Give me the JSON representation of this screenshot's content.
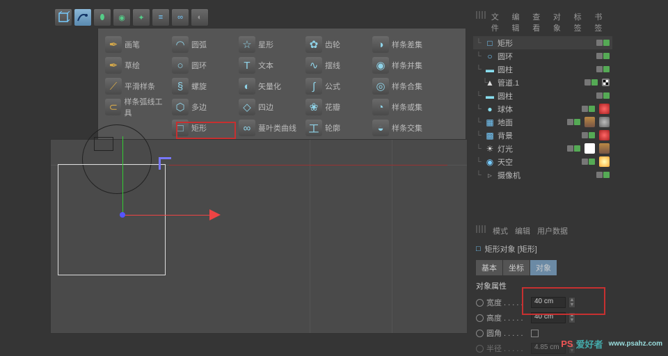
{
  "toolbar": {
    "cube": "◫",
    "pen": "✒"
  },
  "spline_menu": [
    {
      "id": "freehand",
      "label": "画笔",
      "col": "gold",
      "gly": "✒"
    },
    {
      "id": "arc",
      "label": "圆弧",
      "gly": "◠"
    },
    {
      "id": "star",
      "label": "星形",
      "gly": "☆"
    },
    {
      "id": "gear",
      "label": "齿轮",
      "gly": "✿"
    },
    {
      "id": "mask",
      "label": "样条差集",
      "gly": "◑"
    },
    {
      "id": "sketch",
      "label": "草绘",
      "col": "gold",
      "gly": "✒"
    },
    {
      "id": "circle",
      "label": "圆环",
      "gly": "○"
    },
    {
      "id": "text",
      "label": "文本",
      "gly": "T"
    },
    {
      "id": "cycloid",
      "label": "摆线",
      "gly": "∿"
    },
    {
      "id": "union",
      "label": "样条并集",
      "gly": "◉"
    },
    {
      "id": "smooth",
      "label": "平滑样条",
      "col": "gold",
      "gly": "⟋"
    },
    {
      "id": "helix",
      "label": "螺旋",
      "gly": "§"
    },
    {
      "id": "vectorize",
      "label": "矢量化",
      "gly": "◐"
    },
    {
      "id": "formula",
      "label": "公式",
      "gly": "∫"
    },
    {
      "id": "and",
      "label": "样条合集",
      "gly": "◎"
    },
    {
      "id": "arctool",
      "label": "样条弧线工具",
      "col": "gold",
      "gly": "⊂"
    },
    {
      "id": "nside",
      "label": "多边",
      "gly": "⬡"
    },
    {
      "id": "4side",
      "label": "四边",
      "gly": "◇"
    },
    {
      "id": "flower",
      "label": "花瓣",
      "gly": "❀"
    },
    {
      "id": "or",
      "label": "样条或集",
      "gly": "◔"
    },
    {
      "id": "sp1",
      "label": "",
      "gly": ""
    },
    {
      "id": "rectangle",
      "label": "矩形",
      "gly": "□"
    },
    {
      "id": "cissoid",
      "label": "蔓叶类曲线",
      "gly": "∞"
    },
    {
      "id": "profile",
      "label": "轮廓",
      "gly": "工"
    },
    {
      "id": "intersect",
      "label": "样条交集",
      "gly": "◒"
    }
  ],
  "obj_header": [
    "文件",
    "编辑",
    "查看",
    "对象",
    "标签",
    "书签"
  ],
  "objects": [
    {
      "id": "rect",
      "label": "矩形",
      "sel": true,
      "icon": "□",
      "color": "#7cf",
      "tags": []
    },
    {
      "id": "circ",
      "label": "圆环",
      "icon": "○",
      "color": "#7cf",
      "tags": []
    },
    {
      "id": "cyl",
      "label": "圆柱",
      "icon": "▬",
      "color": "#8de",
      "tags": []
    },
    {
      "id": "tube",
      "label": "管道.1",
      "icon": "▲",
      "color": "#ddd",
      "indent": 1,
      "tags": [
        "chk"
      ]
    },
    {
      "id": "cyl2",
      "label": "圆柱",
      "icon": "▬",
      "color": "#8de",
      "tags": []
    },
    {
      "id": "sphere",
      "label": "球体",
      "icon": "●",
      "color": "#8de",
      "tags": [
        "red"
      ]
    },
    {
      "id": "floor",
      "label": "地面",
      "icon": "▦",
      "color": "#7cf",
      "tags": [
        "film",
        "gry"
      ]
    },
    {
      "id": "bg",
      "label": "背景",
      "icon": "▩",
      "color": "#7cf",
      "tags": [
        "red"
      ]
    },
    {
      "id": "light",
      "label": "灯光",
      "icon": "☀",
      "color": "#ddd",
      "tags": [
        "wht",
        "film"
      ]
    },
    {
      "id": "sky",
      "label": "天空",
      "icon": "◉",
      "color": "#7cf",
      "tags": [
        "sun"
      ]
    },
    {
      "id": "cam",
      "label": "摄像机",
      "icon": "▹",
      "color": "#888",
      "tags": []
    }
  ],
  "attr": {
    "hdr": [
      "模式",
      "编辑",
      "用户数据"
    ],
    "title": "矩形对象 [矩形]",
    "tabs": [
      "基本",
      "坐标",
      "对象"
    ],
    "section": "对象属性",
    "width_label": "宽度 . . . . .",
    "height_label": "高度 . . . . .",
    "width_val": "40 cm",
    "height_val": "40 cm",
    "round_label": "圆角 . . . . .",
    "radius_label": "半径 . . . . .",
    "radius_val": "4.85 cm"
  },
  "watermark": {
    "ps": "PS",
    "text": "爱好者",
    "url": "www.psahz.com"
  }
}
